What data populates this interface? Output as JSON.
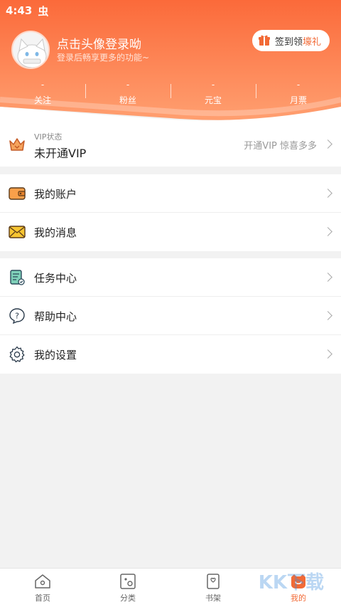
{
  "status_bar": {
    "time": "4:43",
    "app_glyph": "虫"
  },
  "header": {
    "login_title": "点击头像登录呦",
    "login_subtitle": "登录后畅享更多的功能~",
    "checkin_prefix": "签到领",
    "checkin_highlight": "壕礼",
    "stats": [
      {
        "value": "-",
        "label": "关注"
      },
      {
        "value": "-",
        "label": "粉丝"
      },
      {
        "value": "-",
        "label": "元宝"
      },
      {
        "value": "-",
        "label": "月票"
      }
    ],
    "gradient_top": "#fb6b3c",
    "gradient_bottom": "#ff9a6a"
  },
  "vip": {
    "state_label": "VIP状态",
    "state_value": "未开通VIP",
    "promo": "开通VIP 惊喜多多"
  },
  "group1": [
    {
      "label": "我的账户",
      "icon": "wallet-icon"
    },
    {
      "label": "我的消息",
      "icon": "envelope-icon"
    }
  ],
  "group2": [
    {
      "label": "任务中心",
      "icon": "task-list-icon"
    },
    {
      "label": "帮助中心",
      "icon": "help-icon"
    },
    {
      "label": "我的设置",
      "icon": "gear-icon"
    }
  ],
  "tabs": [
    {
      "label": "首页",
      "icon": "home-icon"
    },
    {
      "label": "分类",
      "icon": "category-icon"
    },
    {
      "label": "书架",
      "icon": "bookshelf-icon"
    },
    {
      "label": "我的",
      "icon": "profile-icon",
      "active": true
    }
  ],
  "accent_color": "#f26a36",
  "watermark": "KK下载"
}
